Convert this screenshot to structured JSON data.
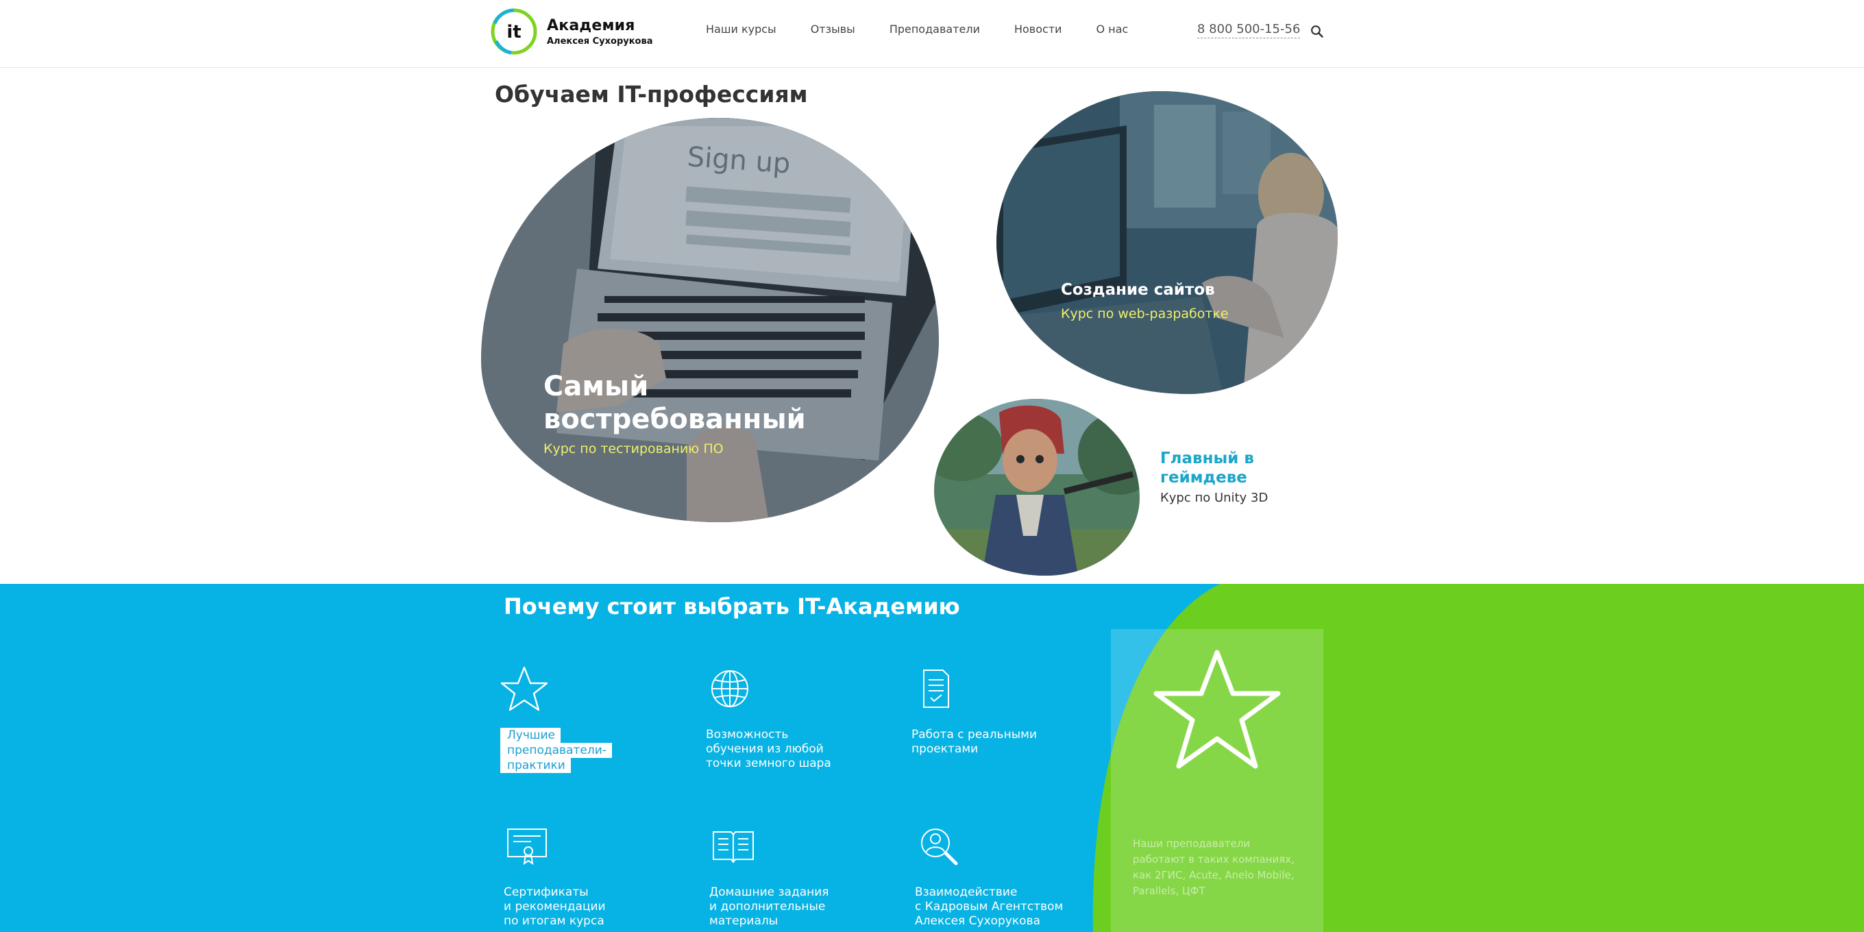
{
  "header": {
    "logo_mark": "it",
    "logo_title": "Академия",
    "logo_subtitle": "Алексея Сухорукова",
    "nav": [
      "Наши курсы",
      "Отзывы",
      "Преподаватели",
      "Новости",
      "О нас"
    ],
    "phone": "8 800 500-15-56",
    "search_icon": "search-icon"
  },
  "hero": {
    "title": "Обучаем IT-профессиям",
    "courses": [
      {
        "title": "Самый востребованный",
        "subtitle": "Курс по тестированию ПО"
      },
      {
        "title": "Создание сайтов",
        "subtitle": "Курс по web-разработке"
      },
      {
        "title": "Главный в геймдеве",
        "subtitle": "Курс по Unity 3D"
      }
    ]
  },
  "why": {
    "title": "Почему стоит выбрать IT-Академию",
    "features": [
      {
        "icon": "star-icon",
        "label": "Лучшие\nпреподаватели-\nпрактики"
      },
      {
        "icon": "globe-icon",
        "label": "Возможность\nобучения из любой\nточки земного шара"
      },
      {
        "icon": "document-icon",
        "label": "Работа с реальными\nпроектами"
      },
      {
        "icon": "certificate-icon",
        "label": "Сертификаты\nи рекомендации\nпо итогам курса"
      },
      {
        "icon": "book-icon",
        "label": "Домашние задания\nи дополнительные\nматериалы"
      },
      {
        "icon": "user-search-icon",
        "label": "Взаимодействие\nс Кадровым Агентством\nАлексея Сухорукова"
      }
    ],
    "side_card_text": "Наши преподаватели работают в таких компаниях, как 2ГИС, Acute, Anelo Mobile, Parallels, ЦФТ"
  },
  "colors": {
    "blue": "#07b2e4",
    "green": "#6ccf1f",
    "accent_yellow": "#f0f06a",
    "accent_teal": "#1aa6c8"
  }
}
